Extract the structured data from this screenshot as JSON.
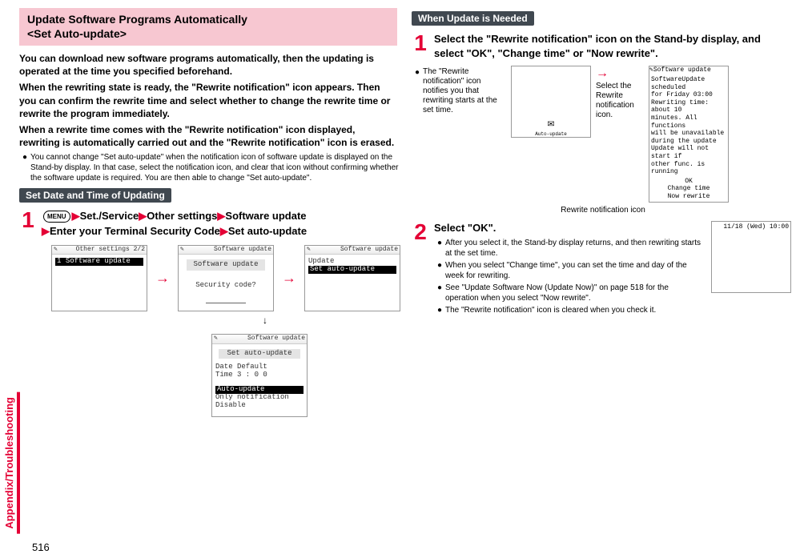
{
  "left": {
    "pinkTitle1": "Update Software Programs Automatically",
    "pinkTitle2": "<Set Auto-update>",
    "intro1": "You can download new software programs automatically, then the updating is operated at the time you specified beforehand.",
    "intro2": "When the rewriting state is ready, the \"Rewrite notification\" icon appears. Then you can confirm the rewrite time and select whether to change the rewrite time or rewrite the program immediately.",
    "intro3": "When a rewrite time comes with the \"Rewrite notification\" icon displayed, rewriting is automatically carried out and the \"Rewrite notification\" icon is erased.",
    "bullet1": "You cannot change \"Set auto-update\" when the notification icon of software update is displayed on the Stand-by display. In that case, select the notification icon, and clear that icon without confirming whether the software update is required. You are then able to change \"Set auto-update\".",
    "setDateHeading": "Set Date and Time of Updating",
    "step1_num": "1",
    "menuKey": "MENU",
    "arrow": "▶",
    "nav_set": "Set./Service",
    "nav_other": "Other settings",
    "nav_sw": "Software update",
    "nav_enter": "Enter your Terminal Security Code",
    "nav_setauto": "Set auto-update",
    "screen1_title": "Other settings  2/2",
    "screen1_item": "Software update",
    "screen2_title": "Software update",
    "screen2_label": "Software update",
    "screen2_prompt": "Security code?",
    "screen3_title": "Software update",
    "screen3_l1": "Update",
    "screen3_l2": "Set auto-update",
    "screen4_title": "Software update",
    "screen4_heading": "Set auto-update",
    "screen4_date": "Date    Default",
    "screen4_time": "Time    3 : 0 0",
    "screen4_opt1": "Auto-update",
    "screen4_opt2": "Only notification",
    "screen4_opt3": "Disable"
  },
  "right": {
    "whenHeading": "When Update is Needed",
    "step1_num": "1",
    "step1_text": "Select the \"Rewrite notification\" icon on the Stand-by display, and select \"OK\", \"Change time\" or \"Now rewrite\".",
    "step1_bullet": "The \"Rewrite notification\" icon notifies you that rewriting starts at the set time.",
    "iconLabel": "Auto-update",
    "annot_select": "Select the Rewrite notification icon.",
    "fig_caption": "Rewrite notification icon",
    "sw_title": "Software update",
    "sw_line1": "SoftwareUpdate scheduled",
    "sw_line2": "for Friday 03:00",
    "sw_line3": "Rewriting time: about 10",
    "sw_line4": "minutes. All functions",
    "sw_line5": "will be unavailable",
    "sw_line6": "during the update",
    "sw_line7": "Update will not start if",
    "sw_line8": "other func. is running",
    "sw_ok": "OK",
    "sw_change": "Change time",
    "sw_now": "Now rewrite",
    "step2_num": "2",
    "step2_text": "Select \"OK\".",
    "step2_b1": "After you select it, the Stand-by display returns, and then rewriting starts at the set time.",
    "step2_b2": "When you select \"Change time\", you can set the time and day of the week for rewriting.",
    "step2_b3": "See \"Update Software Now (Update Now)\" on page 518 for the operation when you select \"Now rewrite\".",
    "step2_b4": "The \"Rewrite notification\" icon is cleared when you check it.",
    "clock": "11/18 (Wed) 10:00"
  },
  "sideTab": "Appendix/Troubleshooting",
  "pageNum": "516",
  "bulletDot": "●",
  "iconGlyph": "✎"
}
